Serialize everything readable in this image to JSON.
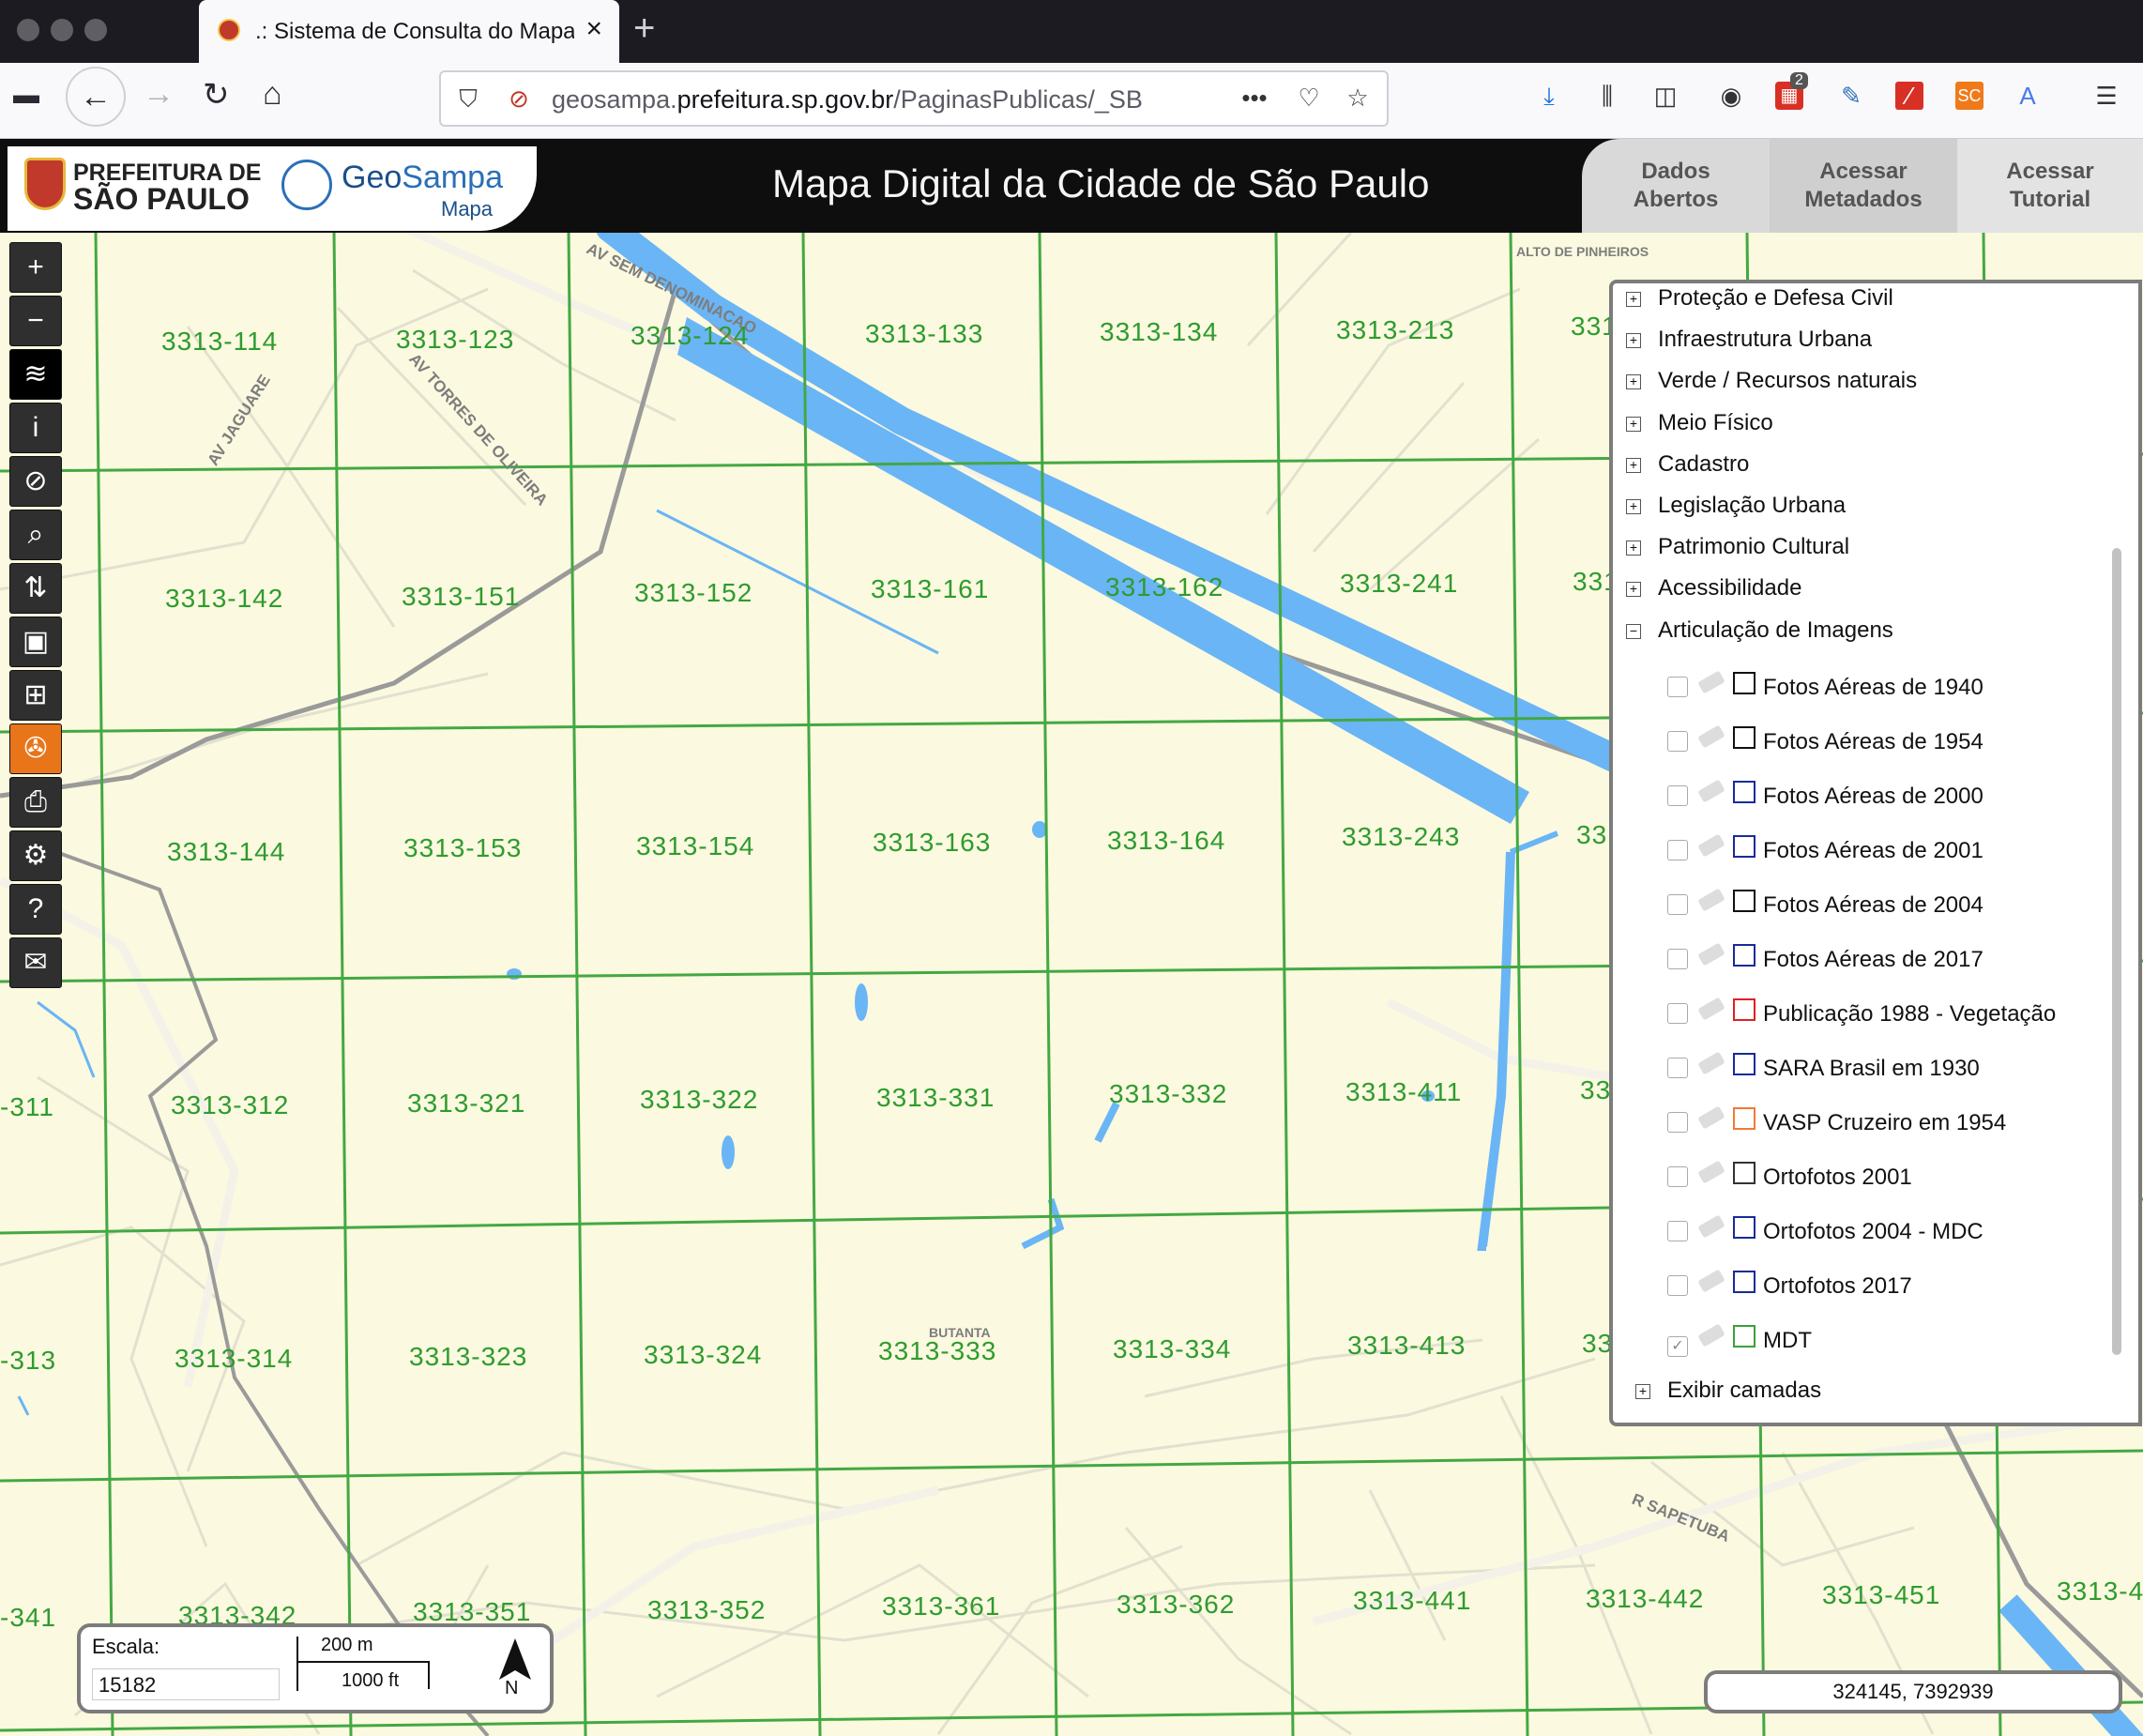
{
  "browser": {
    "tab_title": ".: Sistema de Consulta do Mapa",
    "url_domain_prefix": "geosampa.",
    "url_domain": "prefeitura.sp.gov.br",
    "url_path": "/PaginasPublicas/_SB",
    "notification_badge": "2",
    "ext_sc_label": "SC"
  },
  "header": {
    "pref_line1": "PREFEITURA DE",
    "pref_line2": "SÃO PAULO",
    "geosampa_a": "Geo",
    "geosampa_b": "Sampa",
    "geosampa_sub": "Mapa",
    "title": "Mapa Digital da Cidade de São Paulo",
    "btn_dados": "Dados Abertos",
    "btn_meta": "Acessar Metadados",
    "btn_tut": "Acessar Tutorial"
  },
  "map": {
    "sheets": {
      "s114": "3313-114",
      "s123": "3313-123",
      "s124": "3313-124",
      "s133": "3313-133",
      "s134": "3313-134",
      "s213": "3313-213",
      "s21x": "331",
      "s142": "3313-142",
      "s151": "3313-151",
      "s152": "3313-152",
      "s161": "3313-161",
      "s162": "3313-162",
      "s241": "3313-241",
      "s24x": "331",
      "s144": "3313-144",
      "s153": "3313-153",
      "s154": "3313-154",
      "s163": "3313-163",
      "s164": "3313-164",
      "s243": "3313-243",
      "s24y": "33",
      "s311": "-311",
      "s312": "3313-312",
      "s321": "3313-321",
      "s322": "3313-322",
      "s331": "3313-331",
      "s332": "3313-332",
      "s411": "3313-411",
      "s41x": "33",
      "s313": "-313",
      "s314": "3313-314",
      "s323": "3313-323",
      "s324": "3313-324",
      "s333": "3313-333",
      "s334": "3313-334",
      "s413": "3313-413",
      "s41y": "33",
      "s341": "-341",
      "s342": "3313-342",
      "s351": "3313-351",
      "s352": "3313-352",
      "s361": "3313-361",
      "s362": "3313-362",
      "s441": "3313-441",
      "s442": "3313-442",
      "s451": "3313-451",
      "s45x": "3313-4"
    },
    "streets": {
      "sem_denom": "AV SEM DENOMINACAO",
      "jaguare": "AV JAGUARE",
      "torres": "AV TORRES DE OLIVEIRA",
      "alto_pinheiros": "ALTO DE PINHEIROS",
      "butanta": "BUTANTA",
      "sapetuba": "R SAPETUBA"
    }
  },
  "toolbar": {
    "zoom_in": "+",
    "zoom_out": "−",
    "layers": "≋",
    "info": "i",
    "no_edit": "⊘",
    "search": "⌕",
    "route": "⇅",
    "save": "▣",
    "measure": "⊞",
    "film": "✇",
    "print": "⎙",
    "settings": "⚙",
    "help": "?",
    "mail": "✉"
  },
  "layers": {
    "groups": [
      {
        "label": "Proteção e Defesa Civil",
        "state": "+"
      },
      {
        "label": "Infraestrutura Urbana",
        "state": "+"
      },
      {
        "label": "Verde / Recursos naturais",
        "state": "+"
      },
      {
        "label": "Meio Físico",
        "state": "+"
      },
      {
        "label": "Cadastro",
        "state": "+"
      },
      {
        "label": "Legislação Urbana",
        "state": "+"
      },
      {
        "label": "Patrimonio Cultural",
        "state": "+"
      },
      {
        "label": "Acessibilidade",
        "state": "+"
      },
      {
        "label": "Articulação de Imagens",
        "state": "−"
      }
    ],
    "items": [
      {
        "label": "Fotos Aéreas de 1940",
        "color": "#111111",
        "checked": false
      },
      {
        "label": "Fotos Aéreas de 1954",
        "color": "#111111",
        "checked": false
      },
      {
        "label": "Fotos Aéreas de 2000",
        "color": "#1a2a9a",
        "checked": false
      },
      {
        "label": "Fotos Aéreas de 2001",
        "color": "#1a2a9a",
        "checked": false
      },
      {
        "label": "Fotos Aéreas de 2004",
        "color": "#111111",
        "checked": false
      },
      {
        "label": "Fotos Aéreas de 2017",
        "color": "#1a2a9a",
        "checked": false
      },
      {
        "label": "Publicação 1988 - Vegetação",
        "color": "#e02020",
        "checked": false
      },
      {
        "label": "SARA Brasil em 1930",
        "color": "#1a2a9a",
        "checked": false
      },
      {
        "label": "VASP Cruzeiro em 1954",
        "color": "#f07a3a",
        "checked": false
      },
      {
        "label": "Ortofotos 2001",
        "color": "#333333",
        "checked": false
      },
      {
        "label": "Ortofotos 2004 - MDC",
        "color": "#1a2a9a",
        "checked": false
      },
      {
        "label": "Ortofotos 2017",
        "color": "#1a2a9a",
        "checked": false
      },
      {
        "label": "MDT",
        "color": "#3aa13a",
        "checked": true
      }
    ],
    "exibir": "Exibir camadas",
    "exibir_state": "+"
  },
  "scale": {
    "label": "Escala:",
    "value": "15182",
    "bar_metric": "200 m",
    "bar_imperial": "1000 ft",
    "north": "N"
  },
  "coords": "324145, 7392939"
}
